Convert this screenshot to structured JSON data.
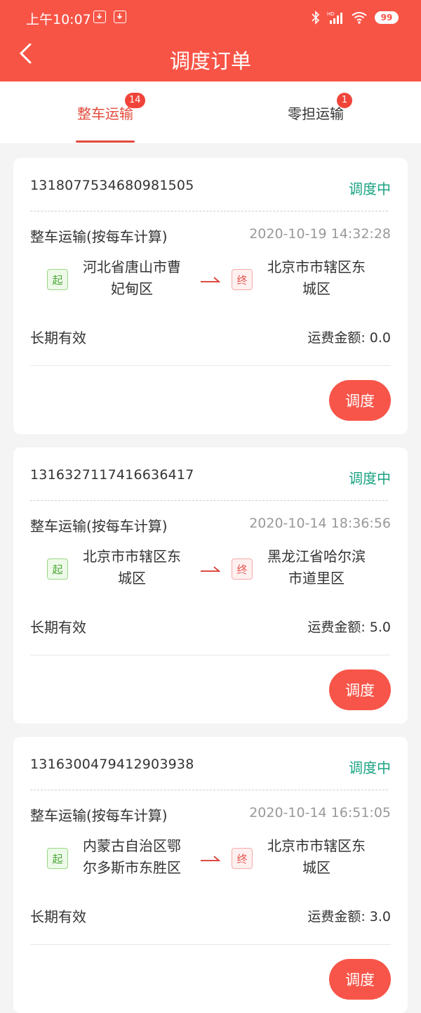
{
  "status_bar": {
    "time": "上午10:07",
    "battery": "99"
  },
  "header": {
    "title": "调度订单"
  },
  "tabs": [
    {
      "label": "整车运输",
      "badge": "14",
      "active": true
    },
    {
      "label": "零担运输",
      "badge": "1",
      "active": false
    }
  ],
  "orders": [
    {
      "id": "1318077534680981505",
      "status": "调度中",
      "transport_type": "整车运输(按每车计算)",
      "datetime": "2020-10-19 14:32:28",
      "start_tag": "起",
      "from": "河北省唐山市曹妃甸区",
      "end_tag": "终",
      "to": "北京市市辖区东城区",
      "validity": "长期有效",
      "fee": "运费金额: 0.0",
      "action": "调度"
    },
    {
      "id": "1316327117416636417",
      "status": "调度中",
      "transport_type": "整车运输(按每车计算)",
      "datetime": "2020-10-14 18:36:56",
      "start_tag": "起",
      "from": "北京市市辖区东城区",
      "end_tag": "终",
      "to": "黑龙江省哈尔滨市道里区",
      "validity": "长期有效",
      "fee": "运费金额: 5.0",
      "action": "调度"
    },
    {
      "id": "1316300479412903938",
      "status": "调度中",
      "transport_type": "整车运输(按每车计算)",
      "datetime": "2020-10-14 16:51:05",
      "start_tag": "起",
      "from": "内蒙古自治区鄂尔多斯市东胜区",
      "end_tag": "终",
      "to": "北京市市辖区东城区",
      "validity": "长期有效",
      "fee": "运费金额: 3.0",
      "action": "调度"
    }
  ],
  "colors": {
    "brand": "#f85446",
    "status": "#1aa383",
    "accent": "#e24a3c"
  }
}
